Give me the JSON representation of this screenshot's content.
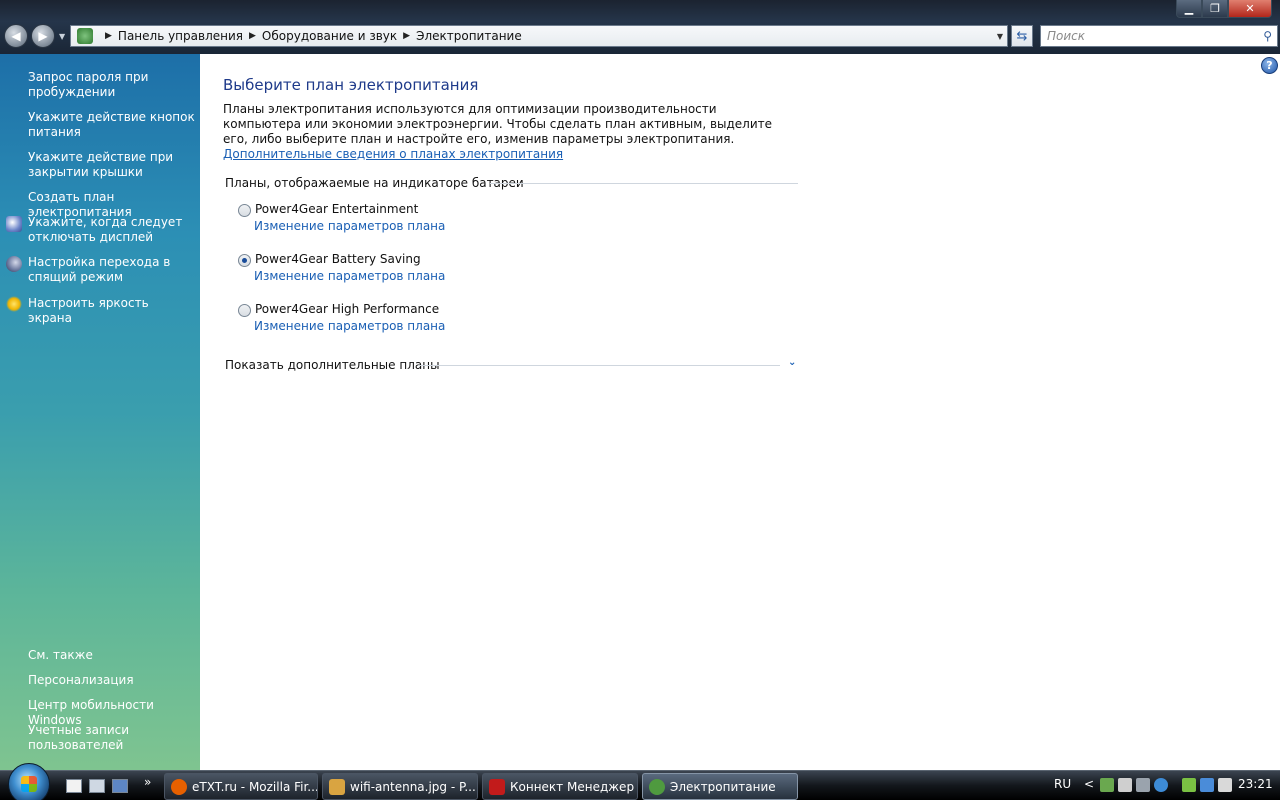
{
  "addressbar": {
    "crumbs": [
      "Панель управления",
      "Оборудование и звук",
      "Электропитание"
    ],
    "search_placeholder": "Поиск"
  },
  "sidebar": {
    "tasks": [
      {
        "label": "Запрос пароля при пробуждении"
      },
      {
        "label": "Укажите действие кнопок питания"
      },
      {
        "label": "Укажите действие при закрытии крышки"
      },
      {
        "label": "Создать план электропитания"
      },
      {
        "label": "Укажите, когда следует отключать дисплей",
        "icon": "display-icon"
      },
      {
        "label": "Настройка перехода в спящий режим",
        "icon": "moon-icon"
      },
      {
        "label": "Настроить яркость экрана",
        "icon": "sun-icon"
      }
    ],
    "see_also_heading": "См. также",
    "see_also": [
      {
        "label": "Персонализация"
      },
      {
        "label": "Центр мобильности Windows"
      },
      {
        "label": "Учетные записи пользователей"
      }
    ]
  },
  "main": {
    "title": "Выберите план электропитания",
    "description": "Планы электропитания используются для оптимизации производительности компьютера или экономии электроэнергии. Чтобы сделать план активным, выделите его, либо выберите план и настройте его, изменив параметры электропитания.",
    "description_link": "Дополнительные сведения о планах электропитания",
    "plans_section": "Планы, отображаемые на индикаторе батареи",
    "plans": [
      {
        "name": "Power4Gear Entertainment",
        "link": "Изменение параметров плана",
        "selected": false
      },
      {
        "name": "Power4Gear Battery Saving",
        "link": "Изменение параметров плана",
        "selected": true
      },
      {
        "name": "Power4Gear High Performance",
        "link": "Изменение параметров плана",
        "selected": false
      }
    ],
    "more_plans": "Показать дополнительные планы"
  },
  "taskbar": {
    "quicklaunch_more": "»",
    "windows": [
      {
        "label": "eTXT.ru - Mozilla Fir...",
        "icon": "firefox-icon",
        "color": "#e66000"
      },
      {
        "label": "wifi-antenna.jpg - P...",
        "icon": "image-viewer-icon",
        "color": "#d9a441"
      },
      {
        "label": "Коннект Менеджер",
        "icon": "connect-manager-icon",
        "color": "#c21b1b"
      },
      {
        "label": "Электропитание",
        "icon": "power-options-icon",
        "color": "#4f9a3f"
      }
    ],
    "language": "RU",
    "tray_chevron": "<",
    "clock": "23:21"
  },
  "colors": {
    "link": "#1a5fb4",
    "title": "#1e3a8a"
  }
}
